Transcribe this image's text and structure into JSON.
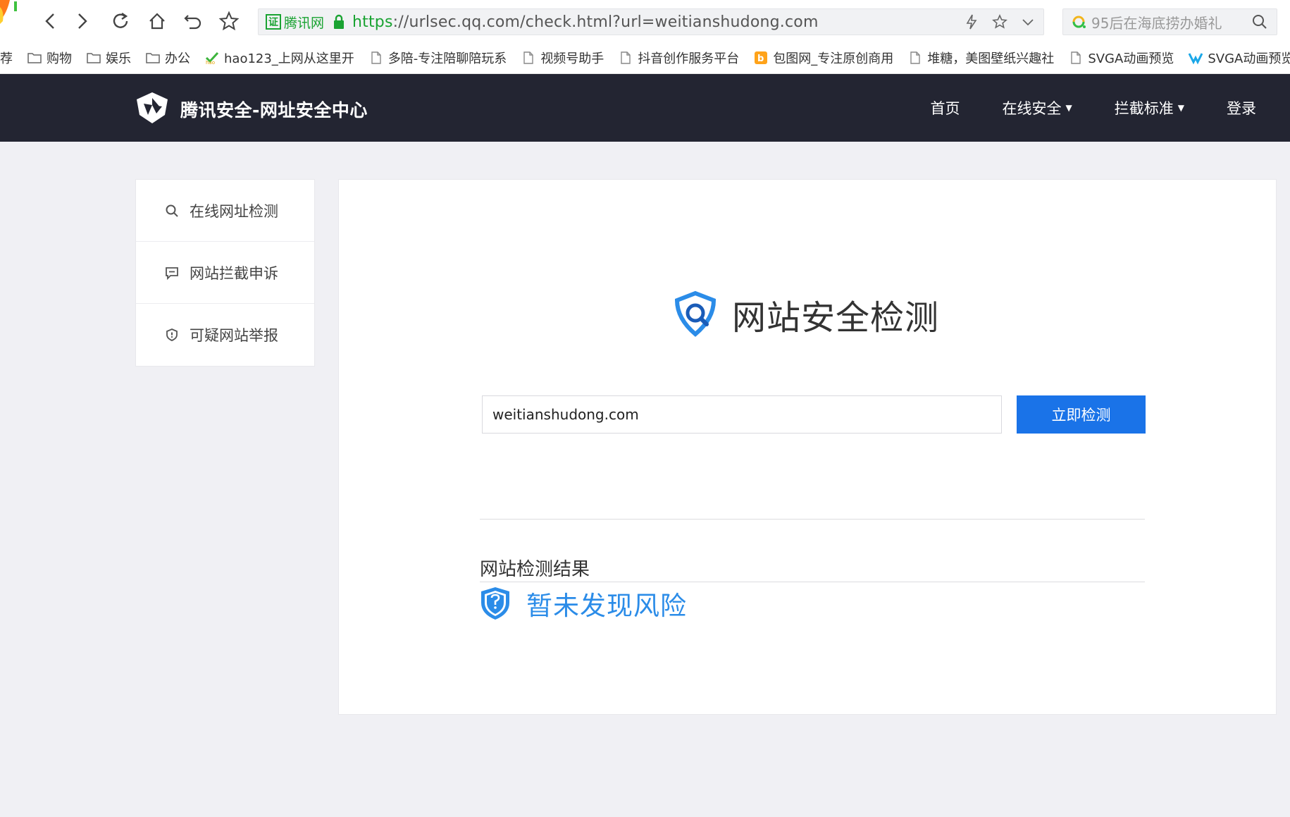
{
  "browser": {
    "address": {
      "cert_label": "腾讯网",
      "cert_box": "证",
      "url_scheme": "https",
      "url_rest": "://urlsec.qq.com/check.html?url=weitianshudong.com"
    },
    "search_hint": "95后在海底捞办婚礼"
  },
  "bookmarks": [
    {
      "label": "荐",
      "icon": "none"
    },
    {
      "label": "购物",
      "icon": "folder-icon"
    },
    {
      "label": "娱乐",
      "icon": "folder-icon"
    },
    {
      "label": "办公",
      "icon": "folder-icon"
    },
    {
      "label": "hao123_上网从这里开",
      "icon": "hao123-icon"
    },
    {
      "label": "多陪-专注陪聊陪玩系",
      "icon": "page-icon"
    },
    {
      "label": "视频号助手",
      "icon": "page-icon"
    },
    {
      "label": "抖音创作服务平台",
      "icon": "page-icon"
    },
    {
      "label": "包图网_专注原创商用",
      "icon": "baotu-icon"
    },
    {
      "label": "堆糖，美图壁纸兴趣社",
      "icon": "page-icon"
    },
    {
      "label": "SVGA动画预览",
      "icon": "page-icon"
    },
    {
      "label": "SVGA动画预览",
      "icon": "svga-icon"
    }
  ],
  "site": {
    "title": "腾讯安全-网址安全中心",
    "nav": {
      "home": "首页",
      "online_security": "在线安全",
      "block_standard": "拦截标准",
      "login": "登录"
    }
  },
  "sidebar": {
    "items": [
      {
        "label": "在线网址检测",
        "icon": "search-icon"
      },
      {
        "label": "网站拦截申诉",
        "icon": "message-icon"
      },
      {
        "label": "可疑网站举报",
        "icon": "shield-alert-icon"
      }
    ]
  },
  "main": {
    "heading": "网站安全检测",
    "input_value": "weitianshudong.com",
    "button_label": "立即检测",
    "result_label": "网站检测结果",
    "result_text": "暂未发现风险"
  },
  "colors": {
    "header_bg": "#232532",
    "accent_blue": "#1a73e8",
    "result_blue": "#2b8ce8",
    "page_bg": "#f0f0f4",
    "secure_green": "#1aa332"
  }
}
